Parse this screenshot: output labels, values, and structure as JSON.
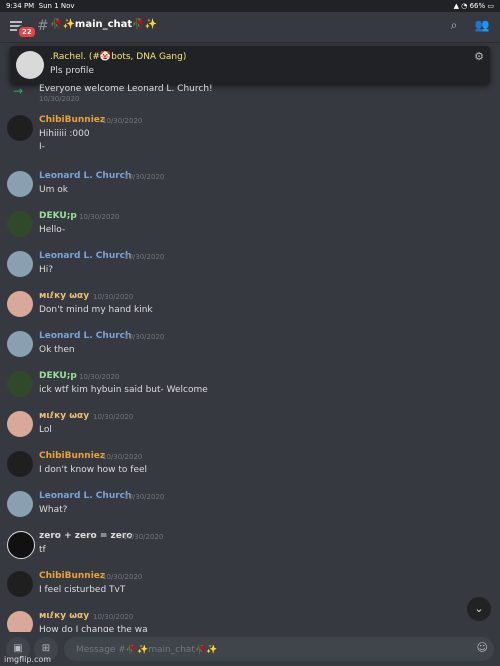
{
  "status": {
    "time": "9:34 PM",
    "date": "Sun 1 Nov",
    "battery": "66%"
  },
  "header": {
    "badge_count": "22",
    "channel_name": "🥀✨main_chat🥀✨",
    "search_icon": "search-icon",
    "members_icon": "members-icon"
  },
  "pinned": {
    "author": ".Rachel. (#🤡bots, DNA Gang)",
    "message": "Pls profile"
  },
  "system": {
    "text": "Everyone welcome Leonard L. Church!",
    "timestamp": "10/30/2020"
  },
  "colors": {
    "chibi": "#e8a33d",
    "leonard": "#7aa4d8",
    "deku": "#9ae29a",
    "milky": "#e8c07a",
    "zero": "#dcddde"
  },
  "messages": [
    {
      "author": "ChibiBunniez",
      "timestamp": "10/30/2020",
      "text": "Hihiiiii :000\nI-"
    },
    {
      "author": "Leonard L. Church",
      "timestamp": "10/30/2020",
      "text": "Um ok"
    },
    {
      "author": "DEKU;p",
      "timestamp": "10/30/2020",
      "text": "Hello-"
    },
    {
      "author": "Leonard L. Church",
      "timestamp": "10/30/2020",
      "text": "Hi?"
    },
    {
      "author": "мιℓку ωαу",
      "timestamp": "10/30/2020",
      "text": "Don't mind my hand kink"
    },
    {
      "author": "Leonard L. Church",
      "timestamp": "10/30/2020",
      "text": "Ok then"
    },
    {
      "author": "DEKU;p",
      "timestamp": "10/30/2020",
      "text": "ick wtf kim hybuin said but- Welcome"
    },
    {
      "author": "мιℓку ωαу",
      "timestamp": "10/30/2020",
      "text": "Lol"
    },
    {
      "author": "ChibiBunniez",
      "timestamp": "10/30/2020",
      "text": "I don't know how to feel"
    },
    {
      "author": "Leonard L. Church",
      "timestamp": "10/30/2020",
      "text": "What?"
    },
    {
      "author": "zero + zero = zero",
      "timestamp": "10/30/2020",
      "text": "tf"
    },
    {
      "author": "ChibiBunniez",
      "timestamp": "10/30/2020",
      "text": "I feel cisturbed TvT"
    },
    {
      "author": "мιℓку ωαу",
      "timestamp": "10/30/2020",
      "text": "How do I change the wa"
    }
  ],
  "composer": {
    "placeholder": "Message #🥀✨main_chat🥀✨",
    "watermark": "imgflip.com"
  }
}
